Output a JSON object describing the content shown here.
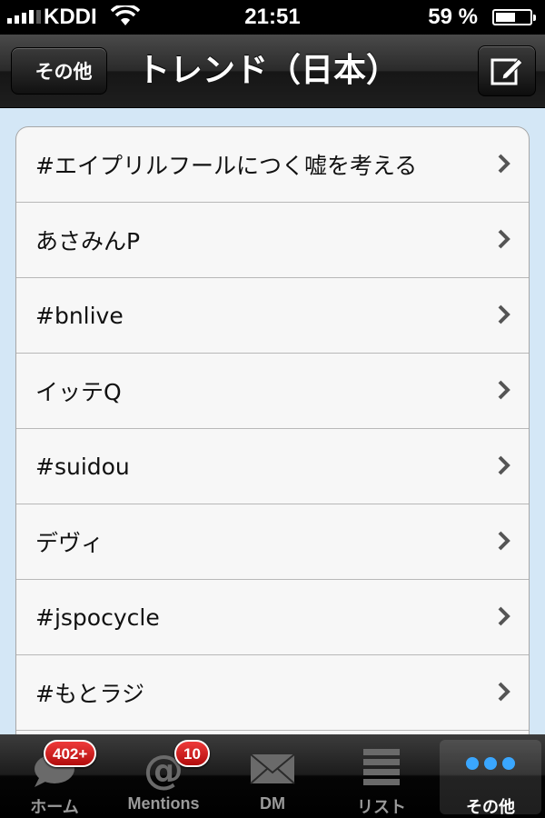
{
  "status_bar": {
    "carrier": "KDDI",
    "time": "21:51",
    "battery": "59 %",
    "battery_level": 0.59
  },
  "nav": {
    "back_label": "その他",
    "title": "トレンド（日本）",
    "compose_icon": "compose-icon"
  },
  "trends": [
    {
      "label": "#エイプリルフールにつく嘘を考える"
    },
    {
      "label": "あさみんP"
    },
    {
      "label": "#bnlive"
    },
    {
      "label": "イッテQ"
    },
    {
      "label": "#suidou"
    },
    {
      "label": "デヴィ"
    },
    {
      "label": "#jspocycle"
    },
    {
      "label": "#もとラジ"
    },
    {
      "label": ""
    }
  ],
  "tabs": [
    {
      "label": "ホーム",
      "badge": "402+",
      "icon": "speech-bubble-icon"
    },
    {
      "label": "Mentions",
      "badge": "10",
      "icon": "at-sign-icon"
    },
    {
      "label": "DM",
      "icon": "envelope-icon"
    },
    {
      "label": "リスト",
      "icon": "list-icon"
    },
    {
      "label": "その他",
      "icon": "more-dots-icon",
      "selected": true
    }
  ],
  "colors": {
    "badge": "#d41d1d",
    "selected_icon": "#3aa7ff",
    "background": "#d4e7f6"
  }
}
